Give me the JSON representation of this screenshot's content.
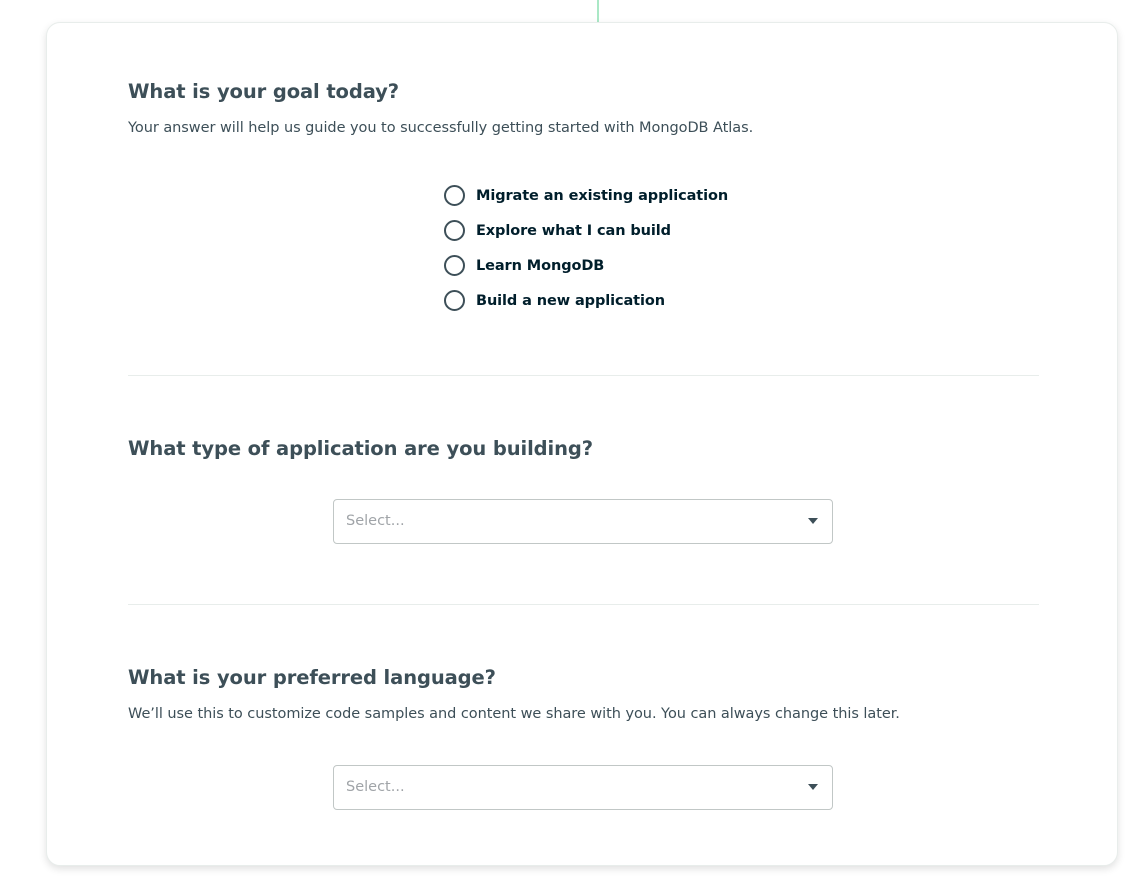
{
  "goal": {
    "heading": "What is your goal today?",
    "description": "Your answer will help us guide you to successfully getting started with MongoDB Atlas.",
    "options": [
      {
        "label": "Migrate an existing application",
        "selected": false
      },
      {
        "label": "Explore what I can build",
        "selected": false
      },
      {
        "label": "Learn MongoDB",
        "selected": false
      },
      {
        "label": "Build a new application",
        "selected": false
      }
    ]
  },
  "app_type": {
    "heading": "What type of application are you building?",
    "select_placeholder": "Select..."
  },
  "language": {
    "heading": "What is your preferred language?",
    "description": "We’ll use this to customize code samples and content we share with you. You can always change this later.",
    "select_placeholder": "Select..."
  },
  "colors": {
    "accent": "#00ed64",
    "leaf_line": "#71d9a0",
    "text": "#3d4f58",
    "divider": "#e8edeb"
  },
  "icons": {
    "leaf_decoration": "mongodb-leaf-line-icon",
    "dropdown": "caret-down-icon"
  }
}
